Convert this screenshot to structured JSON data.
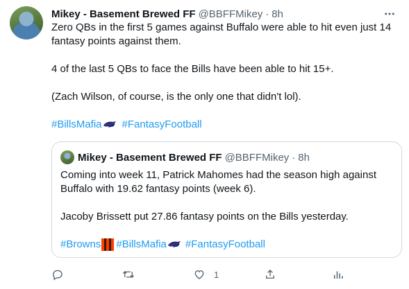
{
  "tweet": {
    "display_name": "Mikey - Basement Brewed FF",
    "handle": "@BBFFMikey",
    "separator": "·",
    "time": "8h",
    "more_icon": "ellipsis-icon",
    "text": {
      "p1": "Zero QBs in the first 5 games against Buffalo were able to hit even just 14 fantasy points against them.",
      "p2": "4 of the last 5 QBs to face the Bills have been able to hit 15+.",
      "p3": "(Zach Wilson, of course, is the only one that didn't lol).",
      "hashtag1": "#BillsMafia",
      "hashtag2": "#FantasyFootball"
    }
  },
  "quote": {
    "display_name": "Mikey - Basement Brewed FF",
    "handle": "@BBFFMikey",
    "separator": "·",
    "time": "8h",
    "text": {
      "p1": "Coming into week 11, Patrick Mahomes had the season high against Buffalo with 19.62 fantasy points (week 6).",
      "p2": "Jacoby Brissett put 27.86 fantasy points on the Bills yesterday.",
      "hashtag1": "#Browns",
      "hashtag2": "#BillsMafia",
      "hashtag3": "#FantasyFootball"
    }
  },
  "actions": {
    "reply_icon": "reply-icon",
    "retweet_icon": "retweet-icon",
    "like_icon": "heart-icon",
    "like_count": "1",
    "share_icon": "share-icon",
    "analytics_icon": "analytics-icon"
  },
  "colors": {
    "link": "#1d9bf0",
    "muted": "#536471",
    "text": "#0f1419",
    "border": "#cfd9de"
  }
}
